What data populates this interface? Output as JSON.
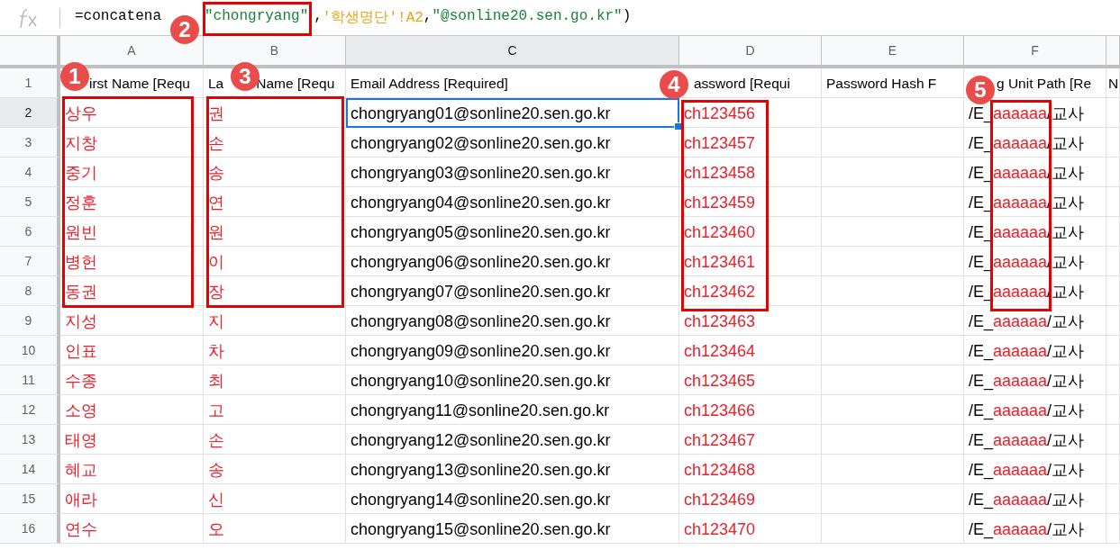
{
  "formula_bar": {
    "tokens": [
      {
        "text": "=concatena",
        "color": "#000000"
      },
      {
        "text": "\"chongryang\"",
        "color": "#188038"
      },
      {
        "text": ","
      },
      {
        "text": "'학생명단'!A2",
        "color": "#e8a317"
      },
      {
        "text": ","
      },
      {
        "text": "\"@sonline20.sen.go.kr\"",
        "color": "#188038"
      },
      {
        "text": ")"
      }
    ]
  },
  "columns": [
    {
      "letter": "A",
      "header": [
        "irst Name [Requ"
      ],
      "color": "#e8202a",
      "selected": false
    },
    {
      "letter": "B",
      "header": [
        "La",
        "Name [Requ"
      ],
      "color": "#e8202a",
      "selected": false
    },
    {
      "letter": "C",
      "header": [
        "Email Address [Required]"
      ],
      "color": "#000000",
      "selected": true
    },
    {
      "letter": "D",
      "header": [
        "assword [Requi"
      ],
      "color": "#e8202a",
      "selected": false
    },
    {
      "letter": "E",
      "header": [
        "Password Hash F"
      ],
      "selected": false
    },
    {
      "letter": "F",
      "header": [
        "g Unit Path [Re"
      ],
      "color": "#000000",
      "selected": false
    },
    {
      "header": [
        "N"
      ],
      "selected": false
    }
  ],
  "rows": [
    {
      "number": "1",
      "kind": "header",
      "selected": false
    },
    {
      "number": "2",
      "first": "상우",
      "last": "권",
      "email": "chongryang01@sonline20.sen.go.kr",
      "password": "ch123456",
      "org": {
        "prefix": "/E_",
        "marked": "aaaaaa",
        "suffix": "/교사"
      },
      "selected": true
    },
    {
      "number": "3",
      "first": "지창",
      "last": "손",
      "email": "chongryang02@sonline20.sen.go.kr",
      "password": "ch123457",
      "org": {
        "prefix": "/E_",
        "marked": "aaaaaa",
        "suffix": "/교사"
      },
      "selected": false
    },
    {
      "number": "4",
      "first": "중기",
      "last": "송",
      "email": "chongryang03@sonline20.sen.go.kr",
      "password": "ch123458",
      "org": {
        "prefix": "/E_",
        "marked": "aaaaaa",
        "suffix": "/교사"
      },
      "selected": false
    },
    {
      "number": "5",
      "first": "정훈",
      "last": "연",
      "email": "chongryang04@sonline20.sen.go.kr",
      "password": "ch123459",
      "org": {
        "prefix": "/E_",
        "marked": "aaaaaa",
        "suffix": "/교사"
      },
      "selected": false
    },
    {
      "number": "6",
      "first": "원빈",
      "last": "원",
      "email": "chongryang05@sonline20.sen.go.kr",
      "password": "ch123460",
      "org": {
        "prefix": "/E_",
        "marked": "aaaaaa",
        "suffix": "/교사"
      },
      "selected": false
    },
    {
      "number": "7",
      "first": "병헌",
      "last": "이",
      "email": "chongryang06@sonline20.sen.go.kr",
      "password": "ch123461",
      "org": {
        "prefix": "/E_",
        "marked": "aaaaaa",
        "suffix": "/교사"
      },
      "selected": false
    },
    {
      "number": "8",
      "first": "동권",
      "last": "장",
      "email": "chongryang07@sonline20.sen.go.kr",
      "password": "ch123462",
      "org": {
        "prefix": "/E_",
        "marked": "aaaaaa",
        "suffix": "/교사"
      },
      "selected": false
    },
    {
      "number": "9",
      "first": "지성",
      "last": "지",
      "email": "chongryang08@sonline20.sen.go.kr",
      "password": "ch123463",
      "org": {
        "prefix": "/E_",
        "marked": "aaaaaa",
        "suffix": "/교사"
      },
      "selected": false
    },
    {
      "number": "10",
      "first": "인표",
      "last": "차",
      "email": "chongryang09@sonline20.sen.go.kr",
      "password": "ch123464",
      "org": {
        "prefix": "/E_",
        "marked": "aaaaaa",
        "suffix": "/교사"
      },
      "selected": false
    },
    {
      "number": "11",
      "first": "수종",
      "last": "최",
      "email": "chongryang10@sonline20.sen.go.kr",
      "password": "ch123465",
      "org": {
        "prefix": "/E_",
        "marked": "aaaaaa",
        "suffix": "/교사"
      },
      "selected": false
    },
    {
      "number": "12",
      "first": "소영",
      "last": "고",
      "email": "chongryang11@sonline20.sen.go.kr",
      "password": "ch123466",
      "org": {
        "prefix": "/E_",
        "marked": "aaaaaa",
        "suffix": "/교사"
      },
      "selected": false
    },
    {
      "number": "13",
      "first": "태영",
      "last": "손",
      "email": "chongryang12@sonline20.sen.go.kr",
      "password": "ch123467",
      "org": {
        "prefix": "/E_",
        "marked": "aaaaaa",
        "suffix": "/교사"
      },
      "selected": false
    },
    {
      "number": "14",
      "first": "혜교",
      "last": "송",
      "email": "chongryang13@sonline20.sen.go.kr",
      "password": "ch123468",
      "org": {
        "prefix": "/E_",
        "marked": "aaaaaa",
        "suffix": "/교사"
      },
      "selected": false
    },
    {
      "number": "15",
      "first": "애라",
      "last": "신",
      "email": "chongryang14@sonline20.sen.go.kr",
      "password": "ch123469",
      "org": {
        "prefix": "/E_",
        "marked": "aaaaaa",
        "suffix": "/교사"
      },
      "selected": false
    },
    {
      "number": "16",
      "first": "연수",
      "last": "오",
      "email": "chongryang15@sonline20.sen.go.kr",
      "password": "ch123470",
      "org": {
        "prefix": "/E_",
        "marked": "aaaaaa",
        "suffix": "/교사"
      },
      "selected": false
    }
  ],
  "annotations": [
    {
      "number": "1"
    },
    {
      "number": "2"
    },
    {
      "number": "3"
    },
    {
      "number": "4"
    },
    {
      "number": "5"
    }
  ]
}
